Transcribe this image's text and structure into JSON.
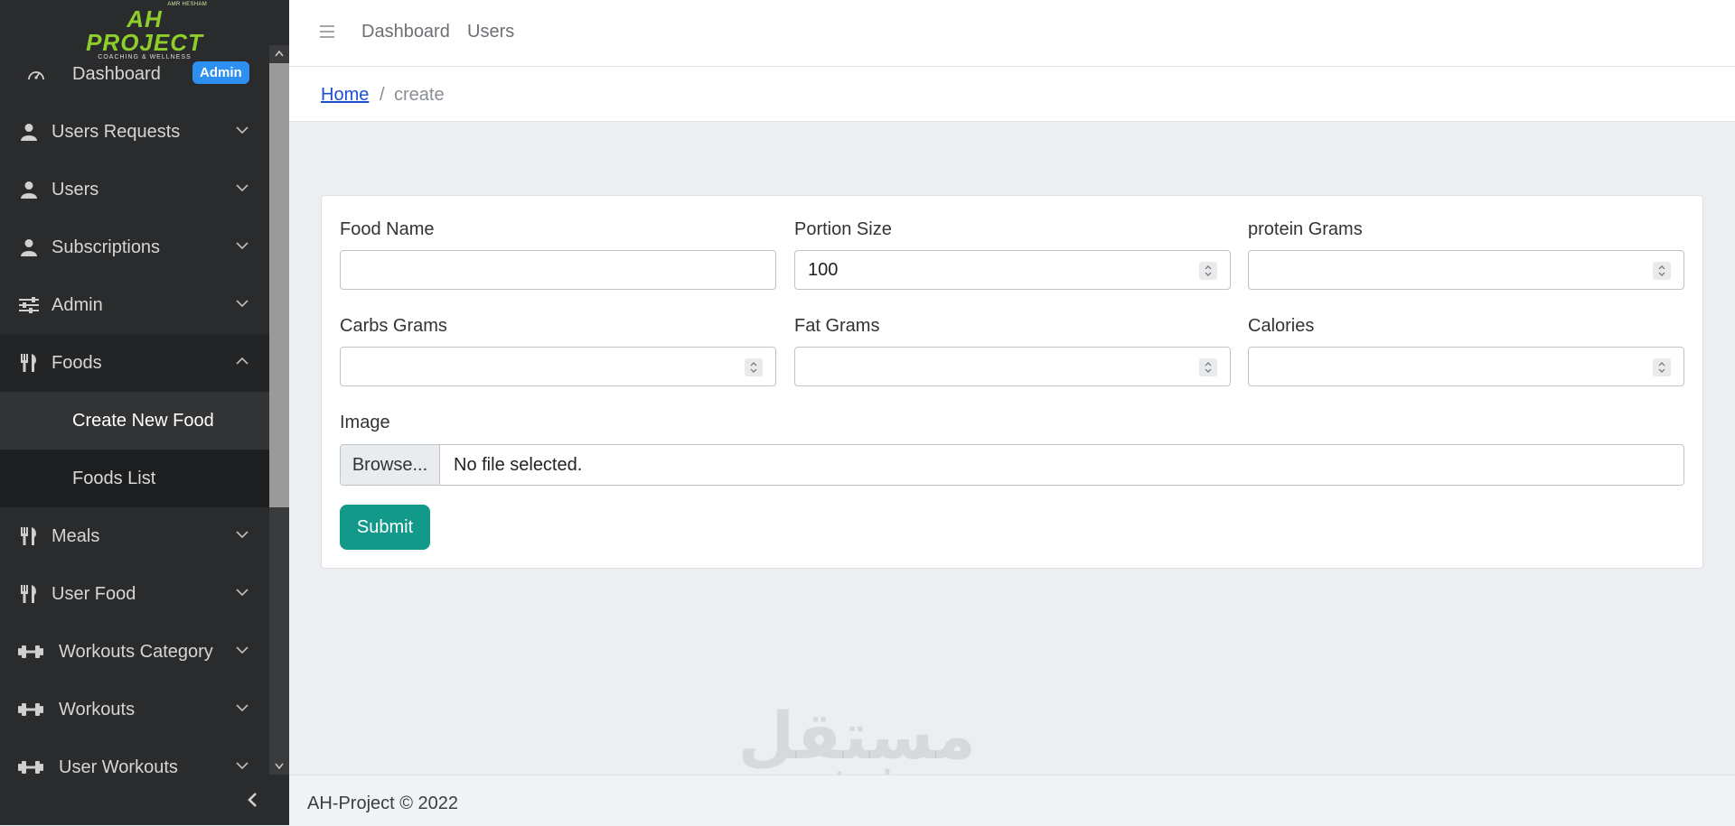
{
  "brand": {
    "top_text": "AMR HESHAM",
    "name": "AH PROJECT",
    "tagline": "COACHING & WELLNESS"
  },
  "sidebar": {
    "dashboard": {
      "label": "Dashboard",
      "badge": "Admin"
    },
    "items": [
      {
        "label": "Users Requests",
        "icon": "user-icon",
        "expanded": false
      },
      {
        "label": "Users",
        "icon": "user-icon",
        "expanded": false
      },
      {
        "label": "Subscriptions",
        "icon": "user-icon",
        "expanded": false
      },
      {
        "label": "Admin",
        "icon": "sliders-icon",
        "expanded": false
      },
      {
        "label": "Foods",
        "icon": "utensils-icon",
        "expanded": true
      },
      {
        "label": "Meals",
        "icon": "utensils-icon",
        "expanded": false
      },
      {
        "label": "User Food",
        "icon": "utensils-icon",
        "expanded": false
      },
      {
        "label": "Workouts Category",
        "icon": "dumbbell-icon",
        "expanded": false
      },
      {
        "label": "Workouts",
        "icon": "dumbbell-icon",
        "expanded": false
      },
      {
        "label": "User Workouts",
        "icon": "dumbbell-icon",
        "expanded": false
      }
    ],
    "foods_submenu": [
      {
        "label": "Create New Food",
        "active": true
      },
      {
        "label": "Foods List",
        "active": false
      }
    ]
  },
  "topbar": {
    "links": [
      "Dashboard",
      "Users"
    ]
  },
  "breadcrumb": {
    "home": "Home",
    "separator": "/",
    "current": "create"
  },
  "form": {
    "food_name": {
      "label": "Food Name",
      "value": ""
    },
    "portion_size": {
      "label": "Portion Size",
      "value": "100"
    },
    "protein_grams": {
      "label": "protein Grams",
      "value": ""
    },
    "carbs_grams": {
      "label": "Carbs Grams",
      "value": ""
    },
    "fat_grams": {
      "label": "Fat Grams",
      "value": ""
    },
    "calories": {
      "label": "Calories",
      "value": ""
    },
    "image": {
      "label": "Image",
      "browse_label": "Browse...",
      "status": "No file selected."
    },
    "submit_label": "Submit"
  },
  "footer": {
    "text": "AH-Project © 2022"
  },
  "watermark": {
    "arabic": "مستقل",
    "latin": "mostaql.com"
  },
  "colors": {
    "sidebar_bg": "#2a2b2d",
    "accent_badge": "#2d8ff0",
    "submit_button": "#12998a",
    "link": "#1f4fd1",
    "logo_green": "#8fce2a"
  }
}
